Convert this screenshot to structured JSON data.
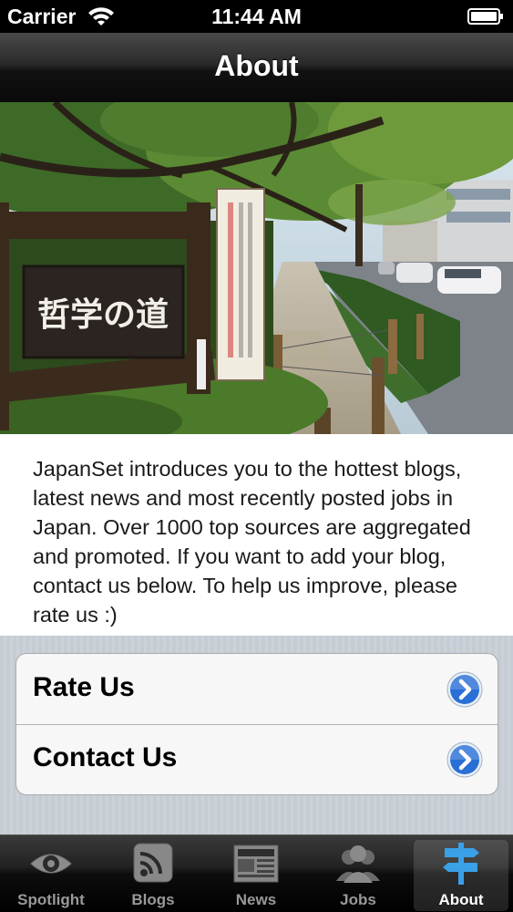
{
  "status_bar": {
    "carrier": "Carrier",
    "time": "11:44 AM"
  },
  "nav": {
    "title": "About"
  },
  "description": "JapanSet introduces you to the hottest blogs, latest news and most recently posted jobs in Japan. Over 1000 top sources are aggregated and promoted. If you want to add your blog, contact us below. To help us improve, please rate us :)",
  "photo": {
    "sign_text": "哲学の道"
  },
  "actions": [
    {
      "label": "Rate Us",
      "icon": "disclosure-icon"
    },
    {
      "label": "Contact Us",
      "icon": "disclosure-icon"
    }
  ],
  "tabs": [
    {
      "label": "Spotlight",
      "icon": "eye-icon",
      "active": false
    },
    {
      "label": "Blogs",
      "icon": "rss-icon",
      "active": false
    },
    {
      "label": "News",
      "icon": "newspaper-icon",
      "active": false
    },
    {
      "label": "Jobs",
      "icon": "people-icon",
      "active": false
    },
    {
      "label": "About",
      "icon": "signpost-icon",
      "active": true
    }
  ],
  "colors": {
    "accent_blue": "#2a6fd6",
    "active_tab_icon": "#3aa0e8",
    "grouped_bg": "#c5ccd4"
  }
}
